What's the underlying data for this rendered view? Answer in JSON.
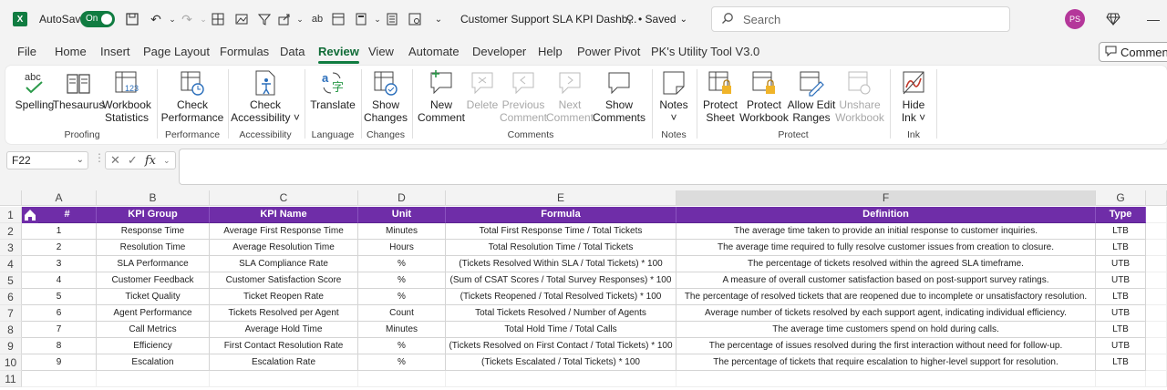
{
  "titlebar": {
    "app_logo": "X",
    "autosave_label": "AutoSave",
    "autosave_state": "On",
    "filename": "Customer Support SLA KPI Dashb...",
    "save_status": "• Saved",
    "search_placeholder": "Search",
    "user_initials": "PS",
    "accent_color": "#107c41"
  },
  "menu": {
    "tabs": [
      "File",
      "Home",
      "Insert",
      "Page Layout",
      "Formulas",
      "Data",
      "Review",
      "View",
      "Automate",
      "Developer",
      "Help",
      "Power Pivot",
      "PK's Utility Tool V3.0"
    ],
    "active": "Review",
    "comments_button": "Comments"
  },
  "ribbon": {
    "buttons": [
      {
        "label": "Spelling",
        "icon": "spelling-icon",
        "enabled": true
      },
      {
        "label": "Thesaurus",
        "icon": "thesaurus-icon",
        "enabled": true
      },
      {
        "label": "Workbook\nStatistics",
        "icon": "workbook-statistics-icon",
        "enabled": true
      },
      {
        "label": "Check\nPerformance",
        "icon": "check-performance-icon",
        "enabled": true
      },
      {
        "label": "Check\nAccessibility ˅",
        "icon": "check-accessibility-icon",
        "enabled": true
      },
      {
        "label": "Translate",
        "icon": "translate-icon",
        "enabled": true
      },
      {
        "label": "Show\nChanges",
        "icon": "show-changes-icon",
        "enabled": true
      },
      {
        "label": "New\nComment",
        "icon": "new-comment-icon",
        "enabled": true
      },
      {
        "label": "Delete",
        "icon": "delete-comment-icon",
        "enabled": false
      },
      {
        "label": "Previous\nComment",
        "icon": "previous-comment-icon",
        "enabled": false
      },
      {
        "label": "Next\nComment",
        "icon": "next-comment-icon",
        "enabled": false
      },
      {
        "label": "Show\nComments",
        "icon": "show-comments-icon",
        "enabled": true
      },
      {
        "label": "Notes\n˅",
        "icon": "notes-icon",
        "enabled": true
      },
      {
        "label": "Protect\nSheet",
        "icon": "protect-sheet-icon",
        "enabled": true
      },
      {
        "label": "Protect\nWorkbook",
        "icon": "protect-workbook-icon",
        "enabled": true
      },
      {
        "label": "Allow Edit\nRanges",
        "icon": "allow-edit-ranges-icon",
        "enabled": true
      },
      {
        "label": "Unshare\nWorkbook",
        "icon": "unshare-workbook-icon",
        "enabled": false
      },
      {
        "label": "Hide\nInk ˅",
        "icon": "hide-ink-icon",
        "enabled": true
      }
    ],
    "groups": [
      "Proofing",
      "Performance",
      "Accessibility",
      "Language",
      "Changes",
      "Comments",
      "Notes",
      "Protect",
      "Ink"
    ]
  },
  "formula_bar": {
    "name_box": "F22",
    "formula": ""
  },
  "sheet": {
    "columns": [
      "A",
      "B",
      "C",
      "D",
      "E",
      "F",
      "G"
    ],
    "selected_column": "F",
    "row_numbers": [
      "1",
      "2",
      "3",
      "4",
      "5",
      "6",
      "7",
      "8",
      "9",
      "10",
      "11"
    ],
    "header_color": "#6f2da8",
    "headers": [
      "#",
      "KPI Group",
      "KPI Name",
      "Unit",
      "Formula",
      "Definition",
      "Type"
    ],
    "rows": [
      [
        "1",
        "Response Time",
        "Average First Response Time",
        "Minutes",
        "Total First Response Time / Total Tickets",
        "The average time taken to provide an initial response to customer inquiries.",
        "LTB"
      ],
      [
        "2",
        "Resolution Time",
        "Average Resolution Time",
        "Hours",
        "Total Resolution Time / Total Tickets",
        "The average time required to fully resolve customer issues from creation to closure.",
        "LTB"
      ],
      [
        "3",
        "SLA Performance",
        "SLA Compliance Rate",
        "%",
        "(Tickets Resolved Within SLA / Total Tickets) * 100",
        "The percentage of tickets resolved within the agreed SLA timeframe.",
        "UTB"
      ],
      [
        "4",
        "Customer Feedback",
        "Customer Satisfaction Score",
        "%",
        "(Sum of CSAT Scores / Total Survey Responses) * 100",
        "A measure of overall customer satisfaction based on post-support survey ratings.",
        "UTB"
      ],
      [
        "5",
        "Ticket Quality",
        "Ticket Reopen Rate",
        "%",
        "(Tickets Reopened / Total Resolved Tickets) * 100",
        "The percentage of resolved tickets that are reopened due to incomplete or unsatisfactory resolution.",
        "LTB"
      ],
      [
        "6",
        "Agent Performance",
        "Tickets Resolved per Agent",
        "Count",
        "Total Tickets Resolved / Number of Agents",
        "Average number of tickets resolved by each support agent, indicating individual efficiency.",
        "UTB"
      ],
      [
        "7",
        "Call Metrics",
        "Average Hold Time",
        "Minutes",
        "Total Hold Time / Total Calls",
        "The average time customers spend on hold during calls.",
        "LTB"
      ],
      [
        "8",
        "Efficiency",
        "First Contact Resolution Rate",
        "%",
        "(Tickets Resolved on First Contact / Total Tickets) * 100",
        "The percentage of issues resolved during the first interaction without need for follow-up.",
        "UTB"
      ],
      [
        "9",
        "Escalation",
        "Escalation Rate",
        "%",
        "(Tickets Escalated / Total Tickets) * 100",
        "The percentage of tickets that require escalation to higher-level support for resolution.",
        "LTB"
      ]
    ]
  }
}
